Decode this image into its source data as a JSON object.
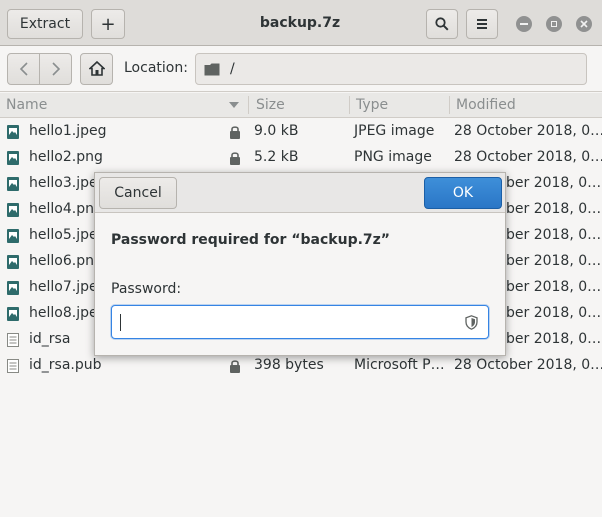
{
  "header": {
    "extract_label": "Extract",
    "add_label": "+",
    "title": "backup.7z"
  },
  "toolbar": {
    "location_label": "Location:",
    "location_value": "/"
  },
  "columns": {
    "name": "Name",
    "size": "Size",
    "type": "Type",
    "modified": "Modified"
  },
  "files": [
    {
      "name": "hello1.jpeg",
      "size": "9.0 kB",
      "type": "JPEG image",
      "modified": "28 October 2018, 0…"
    },
    {
      "name": "hello2.png",
      "size": "5.2 kB",
      "type": "PNG image",
      "modified": "28 October 2018, 0…"
    },
    {
      "name": "hello3.jpe",
      "size": "",
      "type": "",
      "modified": "ber 2018, 0…"
    },
    {
      "name": "hello4.png",
      "size": "",
      "type": "",
      "modified": "ber 2018, 0…"
    },
    {
      "name": "hello5.jpe",
      "size": "",
      "type": "",
      "modified": "ber 2018, 0…"
    },
    {
      "name": "hello6.png",
      "size": "",
      "type": "",
      "modified": "ber 2018, 0…"
    },
    {
      "name": "hello7.jpeg",
      "size": "",
      "type": "",
      "modified": "ber 2018, 0…"
    },
    {
      "name": "hello8.jpe",
      "size": "",
      "type": "",
      "modified": "ber 2018, 0…"
    },
    {
      "name": "id_rsa",
      "size": "",
      "type": "",
      "modified": "ber 2018, 0…"
    },
    {
      "name": "id_rsa.pub",
      "size": "398 bytes",
      "type": "Microsoft P…",
      "modified": "28 October 2018, 0…"
    }
  ],
  "dialog": {
    "cancel_label": "Cancel",
    "ok_label": "OK",
    "message": "Password required for “backup.7z”",
    "password_label": "Password:",
    "password_value": ""
  },
  "colors": {
    "accent": "#2a76c6",
    "image_icon": "#2e6b6b",
    "text_icon": "#888a85"
  }
}
